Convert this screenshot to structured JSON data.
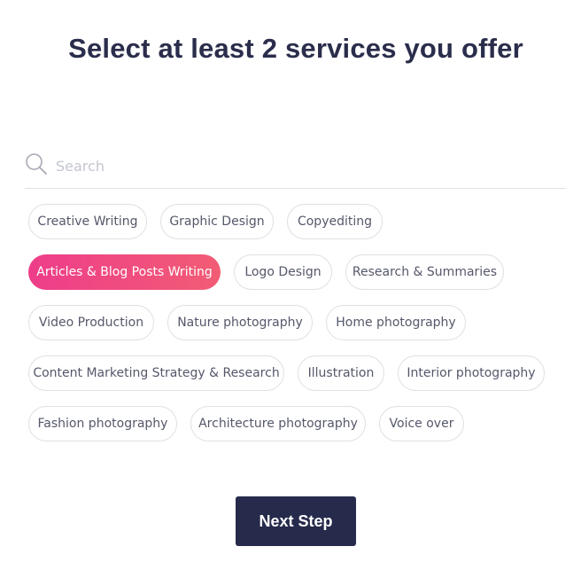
{
  "heading": "Select at least 2 services you offer",
  "search": {
    "placeholder": "Search",
    "value": "",
    "icon": "search-icon"
  },
  "services": [
    {
      "label": "Creative Writing",
      "selected": false
    },
    {
      "label": "Graphic Design",
      "selected": false
    },
    {
      "label": "Copyediting",
      "selected": false
    },
    {
      "label": "Articles & Blog Posts Writing",
      "selected": true
    },
    {
      "label": "Logo Design",
      "selected": false
    },
    {
      "label": "Research & Summaries",
      "selected": false
    },
    {
      "label": "Video Production",
      "selected": false
    },
    {
      "label": "Nature photography",
      "selected": false
    },
    {
      "label": "Home photography",
      "selected": false
    },
    {
      "label": "Content Marketing Strategy & Research",
      "selected": false
    },
    {
      "label": "Illustration",
      "selected": false
    },
    {
      "label": "Interior photography",
      "selected": false
    },
    {
      "label": "Fashion photography",
      "selected": false
    },
    {
      "label": "Architecture photography",
      "selected": false
    },
    {
      "label": "Voice over",
      "selected": false
    }
  ],
  "next_button": "Next Step",
  "colors": {
    "heading": "#2a2d4b",
    "selected_chip_start": "#ee3d8a",
    "selected_chip_end": "#f25c74",
    "button_bg": "#262a4b"
  }
}
